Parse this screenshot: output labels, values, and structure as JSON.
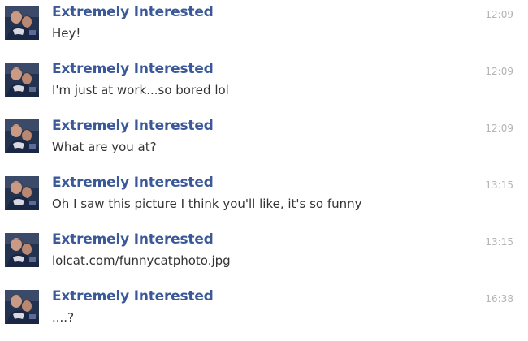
{
  "messages": [
    {
      "sender": "Extremely Interested",
      "text": "Hey!",
      "time": "12:09",
      "avatar_icon": "user-avatar-icon"
    },
    {
      "sender": "Extremely Interested",
      "text": "I'm just at work...so bored lol",
      "time": "12:09",
      "avatar_icon": "user-avatar-icon"
    },
    {
      "sender": "Extremely Interested",
      "text": "What are you at?",
      "time": "12:09",
      "avatar_icon": "user-avatar-icon"
    },
    {
      "sender": "Extremely Interested",
      "text": "Oh I saw this picture I think you'll like, it's so funny",
      "time": "13:15",
      "avatar_icon": "user-avatar-icon"
    },
    {
      "sender": "Extremely Interested",
      "text": "lolcat.com/funnycatphoto.jpg",
      "time": "13:15",
      "avatar_icon": "user-avatar-icon"
    },
    {
      "sender": "Extremely Interested",
      "text": "....?",
      "time": "16:38",
      "avatar_icon": "user-avatar-icon"
    }
  ],
  "colors": {
    "sender": "#3b5998",
    "text": "#333333",
    "time": "#b4b4b4",
    "background": "#ffffff"
  }
}
